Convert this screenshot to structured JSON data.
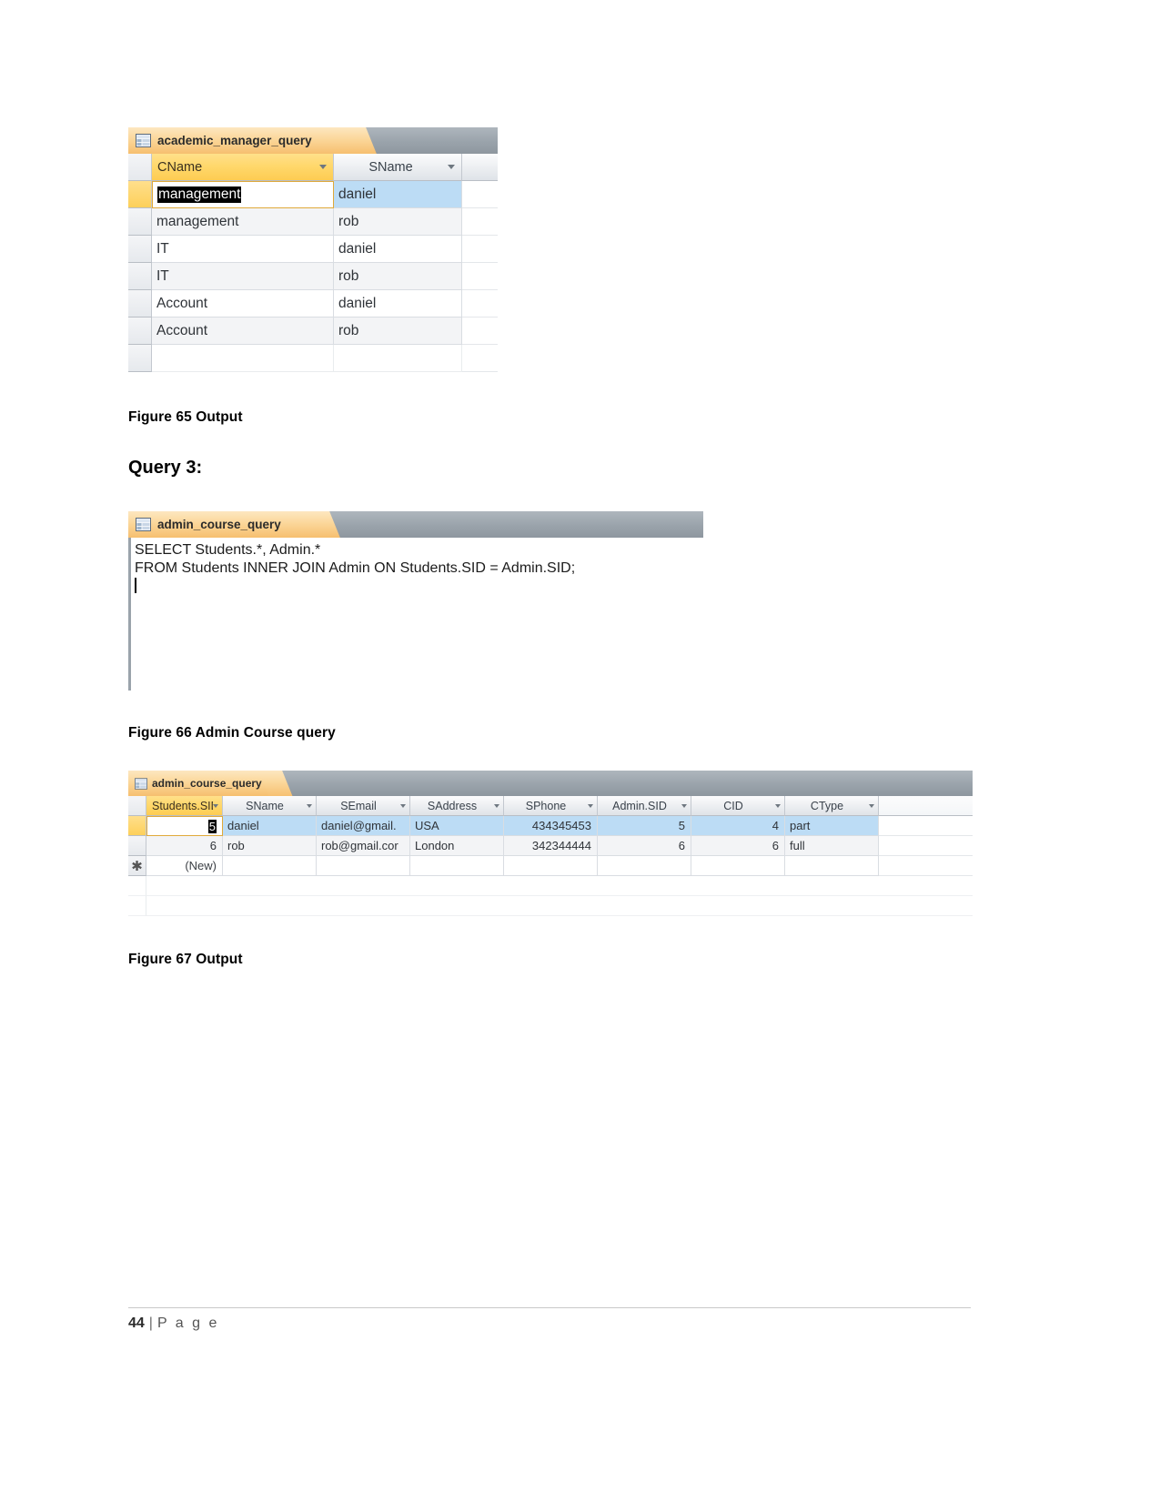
{
  "document": {
    "page_label": "44",
    "page_separator": "|",
    "page_word": "P a g e"
  },
  "figure65": {
    "caption": "Figure 65 Output",
    "datasheet": {
      "tab_label": "academic_manager_query",
      "tab_icon": "datasheet-icon",
      "columns": [
        {
          "name": "CName",
          "selected": true
        },
        {
          "name": "SName",
          "selected": false
        }
      ],
      "rows": [
        {
          "CName": "management",
          "SName": "daniel",
          "selected": true,
          "editing": true
        },
        {
          "CName": "management",
          "SName": "rob",
          "selected": false,
          "editing": false
        },
        {
          "CName": "IT",
          "SName": "daniel",
          "selected": false,
          "editing": false
        },
        {
          "CName": "IT",
          "SName": "rob",
          "selected": false,
          "editing": false
        },
        {
          "CName": "Account",
          "SName": "daniel",
          "selected": false,
          "editing": false
        },
        {
          "CName": "Account",
          "SName": "rob",
          "selected": false,
          "editing": false
        }
      ]
    }
  },
  "query3": {
    "heading": "Query 3",
    "heading_suffix": ":"
  },
  "figure66": {
    "caption": "Figure 66 Admin Course query",
    "sqlview": {
      "tab_label": "admin_course_query",
      "tab_icon": "datasheet-icon",
      "sql_line1": "SELECT Students.*, Admin.*",
      "sql_line2": "FROM Students INNER JOIN Admin ON Students.SID = Admin.SID;"
    }
  },
  "figure67": {
    "caption": "Figure 67 Output",
    "datasheet": {
      "tab_label": "admin_course_query",
      "tab_icon": "datasheet-icon",
      "columns": [
        {
          "name": "Students.SID",
          "selected": true
        },
        {
          "name": "SName",
          "selected": false
        },
        {
          "name": "SEmail",
          "selected": false
        },
        {
          "name": "SAddress",
          "selected": false
        },
        {
          "name": "SPhone",
          "selected": false
        },
        {
          "name": "Admin.SID",
          "selected": false
        },
        {
          "name": "CID",
          "selected": false
        },
        {
          "name": "CType",
          "selected": false
        }
      ],
      "rows": [
        {
          "sid": "5",
          "sname": "daniel",
          "semail": "daniel@gmail.",
          "saddress": "USA",
          "sphone": "434345453",
          "adminsid": "5",
          "cid": "4",
          "ctype": "part",
          "selected": true,
          "editing": true
        },
        {
          "sid": "6",
          "sname": "rob",
          "semail": "rob@gmail.cor",
          "saddress": "London",
          "sphone": "342344444",
          "adminsid": "6",
          "cid": "6",
          "ctype": "full",
          "selected": false,
          "editing": false
        }
      ],
      "new_row": {
        "marker": "✱",
        "label": "(New)"
      }
    }
  },
  "colors": {
    "tab_orange": "#f6bf6f",
    "header_selected": "#fdcc52",
    "row_selected": "#bcdcf5",
    "tabstrip_gray": "#9aa3ab"
  }
}
